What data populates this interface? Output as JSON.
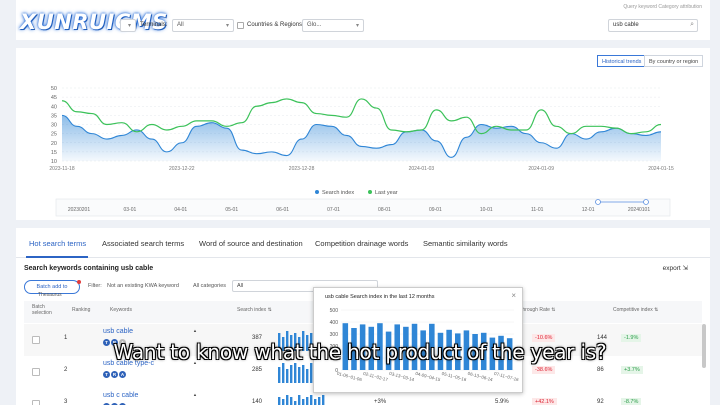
{
  "brand": {
    "logo_text": "XUNRUICMS",
    "color": "#2a6fd8"
  },
  "header": {
    "query_link": "Query keyword Category attribution",
    "terminals_label": "Terminals:",
    "terminals_value": "All",
    "countries_label": "Countries & Regions:",
    "countries_value": "Glo...",
    "search_value": "usb cable"
  },
  "trend": {
    "toggle_historical": "Historical trends",
    "toggle_country": "By country or region",
    "legend_search": "Search index",
    "legend_last": "Last year",
    "colors": {
      "search": "#2f86d6",
      "last": "#3cc25a"
    },
    "range_labels": [
      "20230201",
      "03-01",
      "04-01",
      "05-01",
      "06-01",
      "07-01",
      "08-01",
      "09-01",
      "10-01",
      "11-01",
      "12-01",
      "20240101"
    ]
  },
  "chart_data": {
    "type": "area",
    "x": [
      "2023-11-18",
      "2023-12-22",
      "2023-12-28",
      "2024-01-03",
      "2024-01-09",
      "2024-01-15"
    ],
    "ylim": [
      10,
      50
    ],
    "yticks": [
      10,
      15,
      20,
      25,
      30,
      35,
      40,
      45,
      50
    ],
    "grid": true,
    "legend_position": "bottom",
    "series": [
      {
        "name": "Search index",
        "values": [
          35,
          29,
          25,
          22,
          24,
          27,
          22,
          15,
          20,
          29,
          31,
          28,
          16,
          14,
          15,
          13,
          22,
          30,
          29,
          24,
          18,
          17,
          19,
          26,
          27,
          21,
          12,
          23,
          30,
          28,
          29,
          25,
          20,
          17,
          25,
          22,
          26,
          28,
          25,
          24,
          26
        ]
      },
      {
        "name": "Last year",
        "values": [
          43,
          37,
          36,
          30,
          31,
          26,
          30,
          27,
          29,
          32,
          32,
          29,
          31,
          40,
          42,
          44,
          42,
          36,
          35,
          34,
          44,
          39,
          27,
          26,
          27,
          38,
          32,
          34,
          25,
          29,
          27,
          27,
          38,
          29,
          25,
          29,
          29,
          28,
          25,
          26,
          30
        ]
      }
    ]
  },
  "popup_chart": {
    "type": "bar",
    "title": "usb cable Search index in the last 12 months",
    "ylim": [
      0,
      500
    ],
    "yticks": [
      0,
      100,
      200,
      300,
      400,
      500
    ],
    "x_labels": [
      "01-06~01-06",
      "02-11~02-17",
      "03-13~03-14",
      "04-09~04-15",
      "05-11~05-16",
      "06-13~06-14",
      "07-11~07-16"
    ],
    "values": [
      390,
      350,
      380,
      360,
      390,
      320,
      380,
      360,
      385,
      330,
      385,
      310,
      335,
      305,
      330,
      300,
      310,
      270,
      285,
      265
    ]
  },
  "tabs": [
    "Hot search terms",
    "Associated search terms",
    "Word of source and destination",
    "Competition drainage words",
    "Semantic similarity words"
  ],
  "keywords_section": {
    "title": "Search keywords containing usb cable",
    "export": "export",
    "batch_add": "Batch add to",
    "batch_add_sub": "Thesaurus",
    "filter_label": "Filter:",
    "filter_value": "Not an existing KWA keyword",
    "category_label": "All categories",
    "category_value": "All"
  },
  "table": {
    "headers": [
      "Batch selection",
      "Ranking",
      "Keywords",
      "Search index",
      "through Rate",
      "Competitive index"
    ],
    "rows": [
      {
        "rank": "1",
        "keyword": "usb cable",
        "badges": [
          "T",
          "R",
          "A"
        ],
        "index": "387",
        "change": "",
        "pct": "",
        "growth": "-10.6%",
        "comp": "144",
        "comp_change": "-1.9%"
      },
      {
        "rank": "2",
        "keyword": "usb cable type-c",
        "badges": [
          "T",
          "R",
          "A"
        ],
        "index": "285",
        "change": "",
        "pct": "",
        "growth": "-38.6%",
        "comp": "86",
        "comp_change": "+3.7%"
      },
      {
        "rank": "3",
        "keyword": "usb c cable",
        "badges": [
          "T",
          "R",
          "A"
        ],
        "index": "140",
        "change": "+3%",
        "pct": "5.9%",
        "growth": "+42.1%",
        "comp": "92",
        "comp_change": "-8.7%"
      }
    ]
  },
  "caption": "Want to know what the hot product of the year is?"
}
